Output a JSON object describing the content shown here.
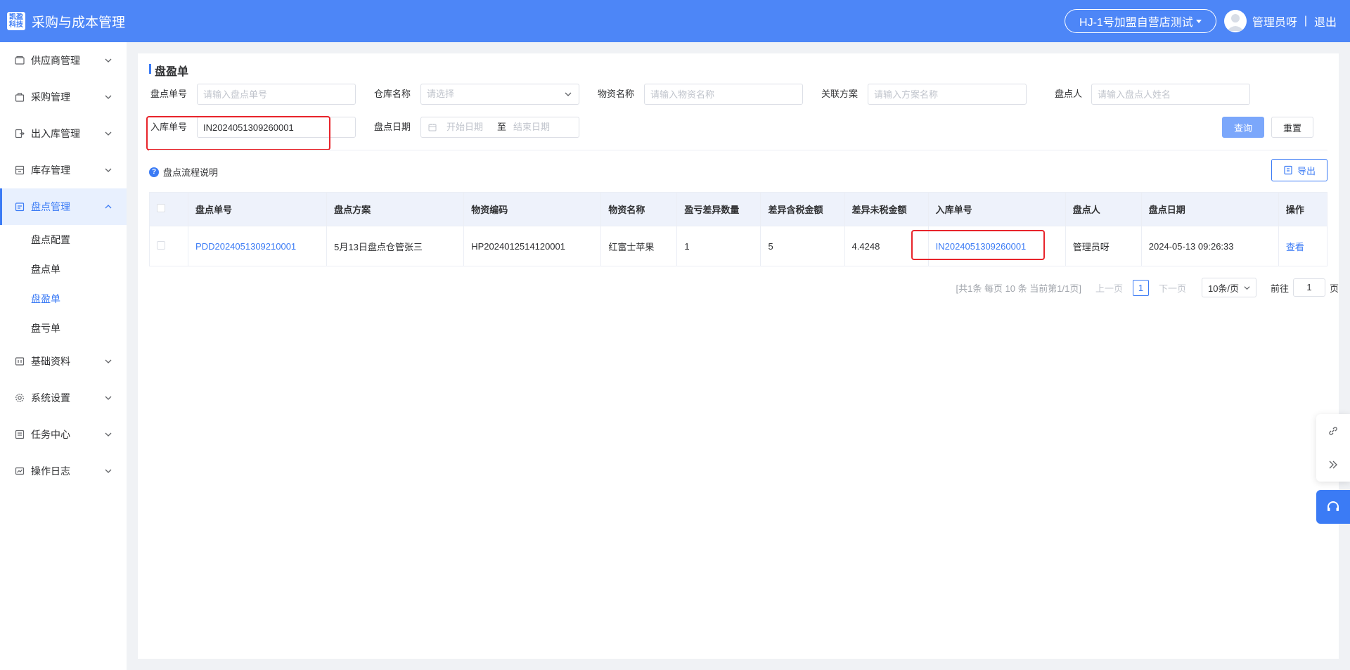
{
  "header": {
    "logo_line1": "凯盈",
    "logo_line2": "科技",
    "app_title": "采购与成本管理",
    "store": "HJ-1号加盟自营店测试",
    "user": "管理员呀",
    "separator": "|",
    "logout": "退出"
  },
  "sidebar": {
    "items": [
      {
        "label": "供应商管理",
        "icon": "supplier-icon"
      },
      {
        "label": "采购管理",
        "icon": "purchase-icon"
      },
      {
        "label": "出入库管理",
        "icon": "inout-icon"
      },
      {
        "label": "库存管理",
        "icon": "inventory-icon"
      },
      {
        "label": "盘点管理",
        "icon": "stocktake-icon"
      },
      {
        "label": "基础资料",
        "icon": "basic-data-icon"
      },
      {
        "label": "系统设置",
        "icon": "settings-icon"
      },
      {
        "label": "任务中心",
        "icon": "task-icon"
      },
      {
        "label": "操作日志",
        "icon": "log-icon"
      }
    ],
    "sub": [
      "盘点配置",
      "盘点单",
      "盘盈单",
      "盘亏单"
    ]
  },
  "page": {
    "title": "盘盈单",
    "filters": {
      "stocktake_no_label": "盘点单号",
      "stocktake_no_placeholder": "请输入盘点单号",
      "warehouse_label": "仓库名称",
      "warehouse_placeholder": "请选择",
      "material_label": "物资名称",
      "material_placeholder": "请输入物资名称",
      "plan_label": "关联方案",
      "plan_placeholder": "请输入方案名称",
      "person_label": "盘点人",
      "person_placeholder": "请输入盘点人姓名",
      "inbound_label": "入库单号",
      "inbound_value": "IN2024051309260001",
      "date_label": "盘点日期",
      "date_start": "开始日期",
      "date_to": "至",
      "date_end": "结束日期"
    },
    "buttons": {
      "query": "查询",
      "reset": "重置",
      "export": "导出"
    },
    "help": "盘点流程说明"
  },
  "table": {
    "columns": [
      "盘点单号",
      "盘点方案",
      "物资编码",
      "物资名称",
      "盈亏差异数量",
      "差异含税金额",
      "差异未税金额",
      "入库单号",
      "盘点人",
      "盘点日期",
      "操作"
    ],
    "rows": [
      {
        "stocktake_no": "PDD2024051309210001",
        "plan": "5月13日盘点仓管张三",
        "material_code": "HP2024012514120001",
        "material_name": "红富士苹果",
        "diff_qty": "1",
        "diff_tax": "5",
        "diff_notax": "4.4248",
        "inbound_no": "IN2024051309260001",
        "person": "管理员呀",
        "date": "2024-05-13 09:26:33",
        "action": "查看"
      }
    ]
  },
  "pagination": {
    "info": "[共1条 每页 10 条 当前第1/1页]",
    "prev": "上一页",
    "current": "1",
    "next": "下一页",
    "size": "10条/页",
    "goto": "前往",
    "goto_value": "1",
    "page_unit": "页"
  },
  "colors": {
    "primary": "#3b7bf5",
    "header": "#4d86f7",
    "highlight": "#e8242b"
  }
}
